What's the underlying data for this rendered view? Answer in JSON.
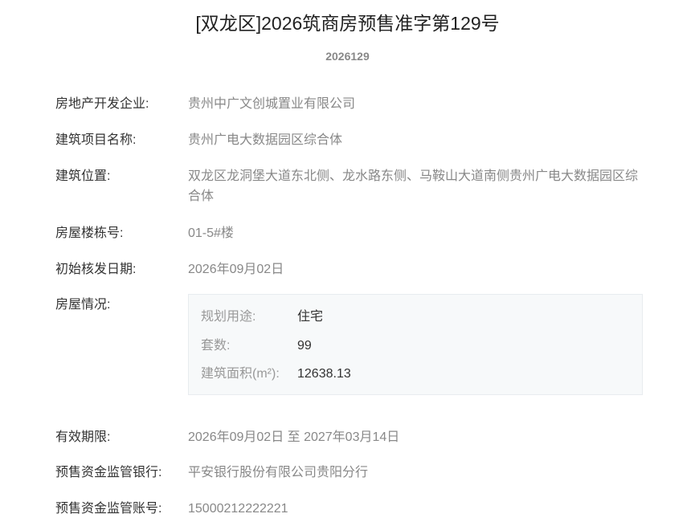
{
  "header": {
    "title": "[双龙区]2026筑商房预售准字第129号",
    "license_no": "2026129"
  },
  "fields": {
    "developer": {
      "label": "房地产开发企业:",
      "value": "贵州中广文创城置业有限公司"
    },
    "project": {
      "label": "建筑项目名称:",
      "value": "贵州广电大数据园区综合体"
    },
    "location": {
      "label": "建筑位置:",
      "value": "双龙区龙洞堡大道东北侧、龙水路东侧、马鞍山大道南侧贵州广电大数据园区综合体"
    },
    "building_no": {
      "label": "房屋楼栋号:",
      "value": "01-5#楼"
    },
    "issue_date": {
      "label": "初始核发日期:",
      "value": "2026年09月02日"
    },
    "house_info": {
      "label": "房屋情况:"
    },
    "validity": {
      "label": "有效期限:",
      "value": "2026年09月02日 至 2027年03月14日"
    },
    "bank": {
      "label": "预售资金监管银行:",
      "value": "平安银行股份有限公司贵阳分行"
    },
    "account": {
      "label": "预售资金监管账号:",
      "value": "15000212222221"
    }
  },
  "house": {
    "usage": {
      "label": "规划用途:",
      "value": "住宅"
    },
    "units": {
      "label": "套数:",
      "value": "99"
    },
    "area": {
      "label": "建筑面积(m²):",
      "value": "12638.13"
    }
  }
}
